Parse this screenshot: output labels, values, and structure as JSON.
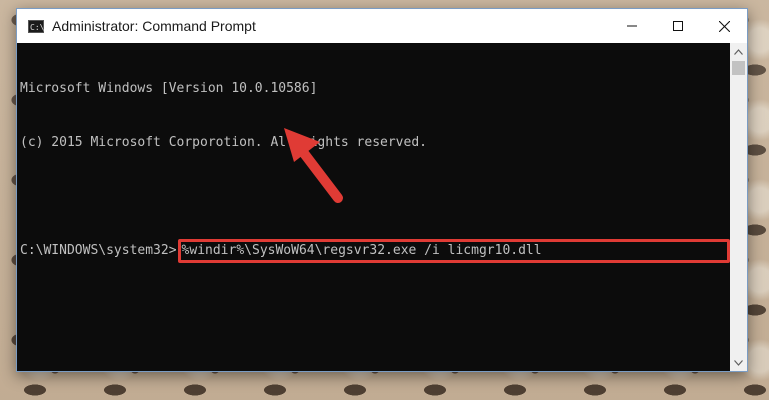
{
  "window": {
    "title": "Administrator: Command Prompt",
    "icon": "cmd-icon",
    "icon_text": "C:\\",
    "controls": [
      "minimize-icon",
      "maximize-icon",
      "close-icon"
    ]
  },
  "console": {
    "lines": [
      "Microsoft Windows [Version 10.0.10586]",
      "(c) 2015 Microsoft Corporotion. All rights reserved.",
      ""
    ],
    "prompt": "C:\\WINDOWS\\system32>",
    "command": "%windir%\\SysWoW64\\regsvr32.exe /i licmgr10.dll"
  },
  "annotation": {
    "highlight_color": "#e03b35",
    "arrow_color": "#e03b35"
  }
}
